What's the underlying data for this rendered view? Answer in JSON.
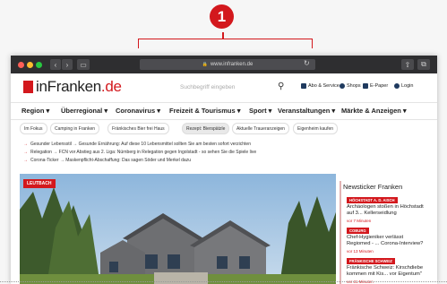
{
  "annotation": {
    "number": "1"
  },
  "browser": {
    "url": "www.infranken.de",
    "back_label": "‹",
    "forward_label": "›",
    "sidebar_label": "▭",
    "reload_label": "↻",
    "share_label": "⇧",
    "tabs_label": "⧉"
  },
  "site": {
    "logo_main": "inFranken",
    "logo_tld": ".de",
    "search_placeholder": "Suchbegriff eingeben",
    "header_links": [
      "Abo & Service",
      "Shops",
      "E-Paper",
      "Login"
    ],
    "nav": [
      "Region ▾",
      "Überregional ▾",
      "Coronavirus ▾",
      "Freizeit & Tourismus ▾",
      "Sport ▾",
      "Veranstaltungen ▾",
      "Märkte & Anzeigen ▾"
    ],
    "chips": [
      "Im Fokus",
      "Camping in Franken",
      "Fränkisches Bier frei Haus",
      "Rezept: Bierspätzle",
      "Aktuelle Traueranzeigen",
      "Eigenheim kaufen"
    ],
    "ticker": [
      "Gesunder Lebensstil → Gesunde Ernährung: Auf diese 10 Lebensmittel sollten Sie am besten sofort verzichten",
      "Relegation → FCN vor Abstieg aus 2. Liga: Nürnberg in Relegation gegen Ingolstadt - so sehen Sie die Spiele live",
      "Corona-Ticker → Maskenpflicht-Abschaffung: Das sagen Söder und Merkel dazu"
    ],
    "hero_label": "LEUTBACH"
  },
  "sidebar": {
    "title": "Newsticker Franken",
    "items": [
      {
        "badge": "HÖCHSTADT A. D. AISCH",
        "text": "Archäologen stoßen in Höchstadt auf 3... Kellerseidlung",
        "time": "vor 7 Minuten"
      },
      {
        "badge": "COBURG",
        "text": "Chef-Hygieniker verlässt Regiomed - ... Corona-Interview?",
        "time": "vor 13 Minuten"
      },
      {
        "badge": "FRÄNKISCHE SCHWEIZ",
        "text": "Fränkische Schweiz: Kirschdiebe kommen mit Kis... vor Eigentum\"",
        "time": "vor 31 Minuten"
      }
    ]
  },
  "colors": {
    "brand_red": "#d3181d",
    "titlebar": "#2e2e30",
    "link_blue": "#1f3a5f"
  }
}
